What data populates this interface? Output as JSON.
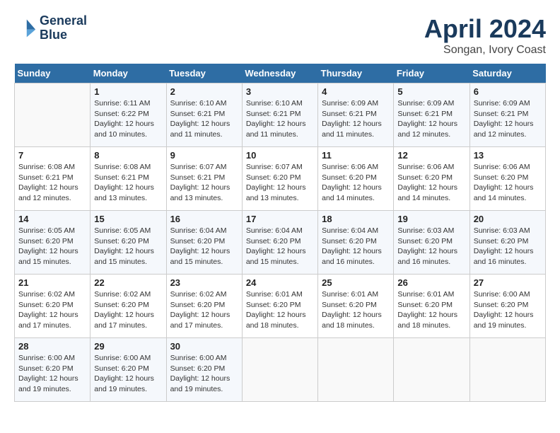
{
  "header": {
    "logo_line1": "General",
    "logo_line2": "Blue",
    "month": "April 2024",
    "location": "Songan, Ivory Coast"
  },
  "weekdays": [
    "Sunday",
    "Monday",
    "Tuesday",
    "Wednesday",
    "Thursday",
    "Friday",
    "Saturday"
  ],
  "weeks": [
    [
      {
        "day": "",
        "info": ""
      },
      {
        "day": "1",
        "info": "Sunrise: 6:11 AM\nSunset: 6:22 PM\nDaylight: 12 hours\nand 10 minutes."
      },
      {
        "day": "2",
        "info": "Sunrise: 6:10 AM\nSunset: 6:21 PM\nDaylight: 12 hours\nand 11 minutes."
      },
      {
        "day": "3",
        "info": "Sunrise: 6:10 AM\nSunset: 6:21 PM\nDaylight: 12 hours\nand 11 minutes."
      },
      {
        "day": "4",
        "info": "Sunrise: 6:09 AM\nSunset: 6:21 PM\nDaylight: 12 hours\nand 11 minutes."
      },
      {
        "day": "5",
        "info": "Sunrise: 6:09 AM\nSunset: 6:21 PM\nDaylight: 12 hours\nand 12 minutes."
      },
      {
        "day": "6",
        "info": "Sunrise: 6:09 AM\nSunset: 6:21 PM\nDaylight: 12 hours\nand 12 minutes."
      }
    ],
    [
      {
        "day": "7",
        "info": "Sunrise: 6:08 AM\nSunset: 6:21 PM\nDaylight: 12 hours\nand 12 minutes."
      },
      {
        "day": "8",
        "info": "Sunrise: 6:08 AM\nSunset: 6:21 PM\nDaylight: 12 hours\nand 13 minutes."
      },
      {
        "day": "9",
        "info": "Sunrise: 6:07 AM\nSunset: 6:21 PM\nDaylight: 12 hours\nand 13 minutes."
      },
      {
        "day": "10",
        "info": "Sunrise: 6:07 AM\nSunset: 6:20 PM\nDaylight: 12 hours\nand 13 minutes."
      },
      {
        "day": "11",
        "info": "Sunrise: 6:06 AM\nSunset: 6:20 PM\nDaylight: 12 hours\nand 14 minutes."
      },
      {
        "day": "12",
        "info": "Sunrise: 6:06 AM\nSunset: 6:20 PM\nDaylight: 12 hours\nand 14 minutes."
      },
      {
        "day": "13",
        "info": "Sunrise: 6:06 AM\nSunset: 6:20 PM\nDaylight: 12 hours\nand 14 minutes."
      }
    ],
    [
      {
        "day": "14",
        "info": "Sunrise: 6:05 AM\nSunset: 6:20 PM\nDaylight: 12 hours\nand 15 minutes."
      },
      {
        "day": "15",
        "info": "Sunrise: 6:05 AM\nSunset: 6:20 PM\nDaylight: 12 hours\nand 15 minutes."
      },
      {
        "day": "16",
        "info": "Sunrise: 6:04 AM\nSunset: 6:20 PM\nDaylight: 12 hours\nand 15 minutes."
      },
      {
        "day": "17",
        "info": "Sunrise: 6:04 AM\nSunset: 6:20 PM\nDaylight: 12 hours\nand 15 minutes."
      },
      {
        "day": "18",
        "info": "Sunrise: 6:04 AM\nSunset: 6:20 PM\nDaylight: 12 hours\nand 16 minutes."
      },
      {
        "day": "19",
        "info": "Sunrise: 6:03 AM\nSunset: 6:20 PM\nDaylight: 12 hours\nand 16 minutes."
      },
      {
        "day": "20",
        "info": "Sunrise: 6:03 AM\nSunset: 6:20 PM\nDaylight: 12 hours\nand 16 minutes."
      }
    ],
    [
      {
        "day": "21",
        "info": "Sunrise: 6:02 AM\nSunset: 6:20 PM\nDaylight: 12 hours\nand 17 minutes."
      },
      {
        "day": "22",
        "info": "Sunrise: 6:02 AM\nSunset: 6:20 PM\nDaylight: 12 hours\nand 17 minutes."
      },
      {
        "day": "23",
        "info": "Sunrise: 6:02 AM\nSunset: 6:20 PM\nDaylight: 12 hours\nand 17 minutes."
      },
      {
        "day": "24",
        "info": "Sunrise: 6:01 AM\nSunset: 6:20 PM\nDaylight: 12 hours\nand 18 minutes."
      },
      {
        "day": "25",
        "info": "Sunrise: 6:01 AM\nSunset: 6:20 PM\nDaylight: 12 hours\nand 18 minutes."
      },
      {
        "day": "26",
        "info": "Sunrise: 6:01 AM\nSunset: 6:20 PM\nDaylight: 12 hours\nand 18 minutes."
      },
      {
        "day": "27",
        "info": "Sunrise: 6:00 AM\nSunset: 6:20 PM\nDaylight: 12 hours\nand 19 minutes."
      }
    ],
    [
      {
        "day": "28",
        "info": "Sunrise: 6:00 AM\nSunset: 6:20 PM\nDaylight: 12 hours\nand 19 minutes."
      },
      {
        "day": "29",
        "info": "Sunrise: 6:00 AM\nSunset: 6:20 PM\nDaylight: 12 hours\nand 19 minutes."
      },
      {
        "day": "30",
        "info": "Sunrise: 6:00 AM\nSunset: 6:20 PM\nDaylight: 12 hours\nand 19 minutes."
      },
      {
        "day": "",
        "info": ""
      },
      {
        "day": "",
        "info": ""
      },
      {
        "day": "",
        "info": ""
      },
      {
        "day": "",
        "info": ""
      }
    ]
  ]
}
